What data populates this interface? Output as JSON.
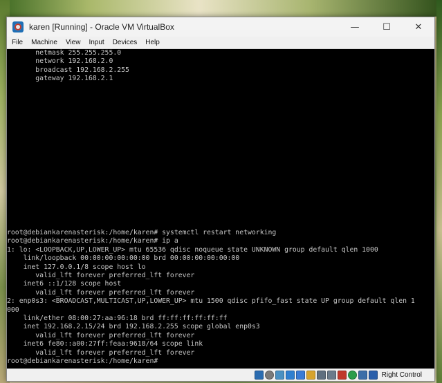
{
  "window": {
    "title": "karen [Running] - Oracle VM VirtualBox",
    "controls": {
      "minimize": "—",
      "maximize": "☐",
      "close": "✕"
    }
  },
  "menubar": {
    "items": [
      "File",
      "Machine",
      "View",
      "Input",
      "Devices",
      "Help"
    ]
  },
  "console": {
    "top_lines": "       netmask 255.255.255.0\n       network 192.168.2.0\n       broadcast 192.168.2.255\n       gateway 192.168.2.1",
    "bottom_lines": "root@debiankarenasterisk:/home/karen# systemctl restart networking\nroot@debiankarenasterisk:/home/karen# ip a\n1: lo: <LOOPBACK,UP,LOWER_UP> mtu 65536 qdisc noqueue state UNKNOWN group default qlen 1000\n    link/loopback 00:00:00:00:00:00 brd 00:00:00:00:00:00\n    inet 127.0.0.1/8 scope host lo\n       valid_lft forever preferred_lft forever\n    inet6 ::1/128 scope host\n       valid_lft forever preferred_lft forever\n2: enp0s3: <BROADCAST,MULTICAST,UP,LOWER_UP> mtu 1500 qdisc pfifo_fast state UP group default qlen 1\n000\n    link/ether 08:00:27:aa:96:18 brd ff:ff:ff:ff:ff:ff\n    inet 192.168.2.15/24 brd 192.168.2.255 scope global enp0s3\n       valid_lft forever preferred_lft forever\n    inet6 fe80::a00:27ff:feaa:9618/64 scope link\n       valid_lft forever preferred_lft forever\nroot@debiankarenasterisk:/home/karen# "
  },
  "statusbar": {
    "icons": [
      "hard-disk-icon",
      "optical-drive-icon",
      "audio-icon",
      "network-icon",
      "usb-icon",
      "shared-folders-icon",
      "display-icon",
      "video-capture-icon",
      "recording-icon",
      "mouse-integration-icon",
      "cpu-icon",
      "keyboard-capture-icon"
    ],
    "icon_colors": [
      "#2b6cb0",
      "#7a7a7a",
      "#4a90c2",
      "#2f7fd0",
      "#3a7bd5",
      "#d6a32e",
      "#5f6f7f",
      "#6b7b8b",
      "#c0392b",
      "#2a9d4b",
      "#3c6ea8",
      "#2a5faa"
    ],
    "host_key": "Right Control"
  }
}
